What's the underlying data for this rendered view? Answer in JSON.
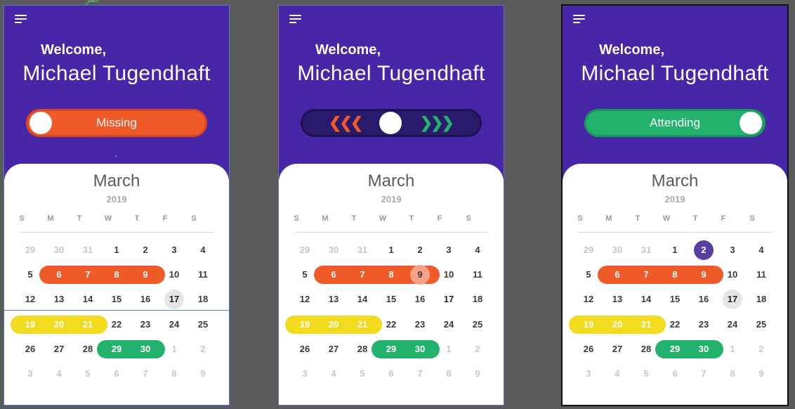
{
  "design_tool": {
    "label": "path"
  },
  "screens": [
    {
      "welcome": "Welcome,",
      "name": "Michael Tugendhaft",
      "toggle_state": "missing",
      "toggle_label": "Missing",
      "highlight_day": "9",
      "highlight_style": "orange",
      "calendar": {
        "month": "March",
        "year": "2019"
      }
    },
    {
      "welcome": "Welcome,",
      "name": "Michael Tugendhaft",
      "toggle_state": "neutral",
      "toggle_label": "",
      "left_chevrons": "❮❮❮",
      "right_chevrons": "❯❯❯",
      "highlight_day": "9",
      "highlight_style": "peach",
      "calendar": {
        "month": "March",
        "year": "2019"
      }
    },
    {
      "welcome": "Welcome,",
      "name": "Michael Tugendhaft",
      "toggle_state": "attending",
      "toggle_label": "Attending",
      "highlight_day": "2",
      "highlight_style": "purple",
      "calendar": {
        "month": "March",
        "year": "2019"
      }
    }
  ],
  "weekdays": [
    "S",
    "M",
    "T",
    "W",
    "T",
    "F",
    "S"
  ],
  "weeks": [
    [
      "29",
      "30",
      "31",
      "1",
      "2",
      "3",
      "4"
    ],
    [
      "5",
      "6",
      "7",
      "8",
      "9",
      "10",
      "11"
    ],
    [
      "12",
      "13",
      "14",
      "15",
      "16",
      "17",
      "18"
    ],
    [
      "19",
      "20",
      "21",
      "22",
      "23",
      "24",
      "25"
    ],
    [
      "26",
      "27",
      "28",
      "29",
      "30",
      "1",
      "2"
    ],
    [
      "3",
      "4",
      "5",
      "6",
      "7",
      "8",
      "9"
    ]
  ],
  "out_of_month": {
    "first_row_count": 3,
    "fifth_row_from_col": 5
  },
  "today": "17",
  "ranges": [
    {
      "color": "orange",
      "days": [
        "6",
        "7",
        "8",
        "9"
      ]
    },
    {
      "color": "yellow",
      "days": [
        "19",
        "20",
        "21"
      ]
    },
    {
      "color": "green",
      "days": [
        "29",
        "30"
      ]
    }
  ],
  "colors": {
    "purple_bg": "#4727a7",
    "orange": "#f05a28",
    "yellow": "#f2db1f",
    "green": "#22b26b",
    "navy_track": "#2a1a6b",
    "today_gray": "#e6e6e6",
    "peach": "#f4a388",
    "purple_circle": "#5b3fa0"
  },
  "icons": {
    "menu": "hamburger-menu-icon"
  }
}
